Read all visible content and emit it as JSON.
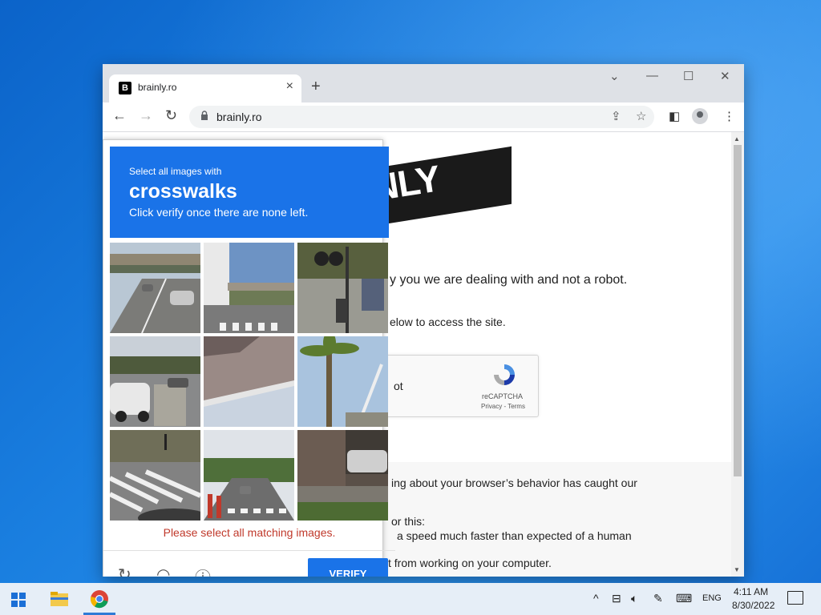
{
  "browser": {
    "tab_title": "brainly.ro",
    "favicon_letter": "B",
    "url": "brainly.ro",
    "new_tab_symbol": "+",
    "tab_close_symbol": "×"
  },
  "page": {
    "logo": "AINLY",
    "line1": "y you we are dealing with and not a robot.",
    "line2": "elow to access the site.",
    "recaptcha_label": "ot",
    "recaptcha_brand": "reCAPTCHA",
    "recaptcha_links": "Privacy - Terms",
    "info_line1": "ing about your browser’s behavior has caught our",
    "info_line2": "or this:",
    "info_line3": "a speed much faster than expected of a human",
    "info_line4": "t from working on your computer."
  },
  "captcha": {
    "instruction": "Select all images with",
    "keyword": "crosswalks",
    "subtext": "Click verify once there are none left.",
    "error": "Please select all matching images.",
    "verify_label": "VERIFY",
    "tiles": [
      "highway-overpass",
      "street-overpass-crosswalk",
      "traffic-light-pedestrian",
      "highway-car",
      "rooftop",
      "palm-tree",
      "crosswalk-closeup",
      "road-crosswalk",
      "wall-car"
    ]
  },
  "taskbar": {
    "language": "ENG",
    "time": "4:11 AM",
    "date": "8/30/2022"
  },
  "colors": {
    "captcha_blue": "#1a73e8",
    "error_red": "#c0392b",
    "desktop_blue": "#1a7fe0"
  }
}
